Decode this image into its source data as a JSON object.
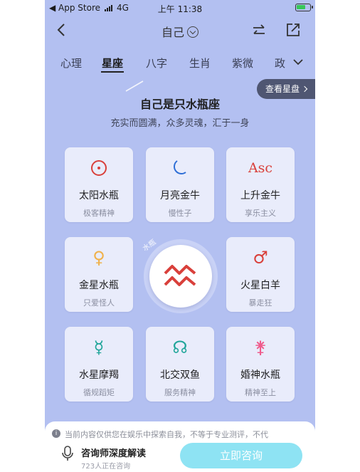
{
  "status_bar": {
    "carrier": "◀ App Store",
    "network": "4G",
    "time": "上午 11:38"
  },
  "nav": {
    "title": "自己"
  },
  "tabs": [
    {
      "label": "心理"
    },
    {
      "label": "星座",
      "active": true
    },
    {
      "label": "八字"
    },
    {
      "label": "生肖"
    },
    {
      "label": "紫微"
    },
    {
      "label": "政"
    }
  ],
  "view_chart_label": "查看星盘",
  "heading": "自己是只水瓶座",
  "subheading": "充实而圆满，众多灵魂，汇于一身",
  "cards": [
    {
      "name": "太阳水瓶",
      "desc": "极客精神",
      "icon": "sun-icon",
      "color": "#d9403b"
    },
    {
      "name": "月亮金牛",
      "desc": "慢性子",
      "icon": "moon-icon",
      "color": "#2f6fd6"
    },
    {
      "name": "上升金牛",
      "desc": "享乐主义",
      "icon": "ascendant-icon",
      "icon_text": "Asc",
      "color": "#d9403b"
    },
    {
      "name": "金星水瓶",
      "desc": "只爱怪人",
      "icon": "venus-icon",
      "icon_text": "♀",
      "color": "#f0b14a"
    },
    {
      "name": "火星白羊",
      "desc": "暴走狂",
      "icon": "mars-icon",
      "icon_text": "♂",
      "color": "#d9403b"
    },
    {
      "name": "水星摩羯",
      "desc": "循规蹈矩",
      "icon": "mercury-icon",
      "icon_text": "☿",
      "color": "#20a59a"
    },
    {
      "name": "北交双鱼",
      "desc": "服务精神",
      "icon": "north-node-icon",
      "icon_text": "☊",
      "color": "#20a59a"
    },
    {
      "name": "婚神水瓶",
      "desc": "精神至上",
      "icon": "juno-icon",
      "icon_text": "⚵",
      "color": "#ef5b8c"
    }
  ],
  "center": {
    "sign_icon": "aquarius-icon",
    "tag": "水瓶",
    "color": "#d9403b"
  },
  "notice": "当前内容仅供您在娱乐中探索自我，不等于专业测评，不代",
  "bottom": {
    "title": "咨询师深度解读",
    "subtitle": "723人正在咨询",
    "cta": "立即咨询"
  },
  "colors": {
    "background": "#b3c0f1",
    "card": "#e9ecfb",
    "cta": "#8ee3f3"
  }
}
